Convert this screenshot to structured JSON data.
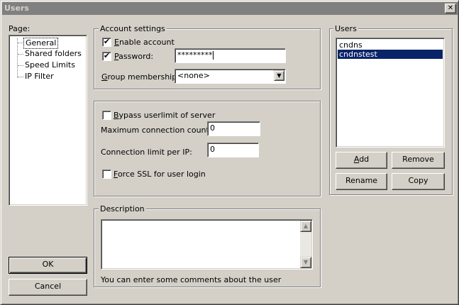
{
  "window": {
    "title": "Users",
    "close_glyph": "✕"
  },
  "page_panel": {
    "label": "Page:",
    "items": [
      "General",
      "Shared folders",
      "Speed Limits",
      "IP Filter"
    ],
    "selected_index": 0
  },
  "account_settings": {
    "title": "Account settings",
    "enable_account": {
      "label": "Enable account",
      "checked": true
    },
    "password": {
      "label": "Password:",
      "checked": true,
      "value": "*********"
    },
    "group_membership": {
      "label": "Group membership:",
      "value": "<none>"
    }
  },
  "limits": {
    "bypass_userlimit": {
      "label": "Bypass userlimit of server",
      "checked": false
    },
    "max_connections": {
      "label": "Maximum connection count:",
      "value": "0"
    },
    "connection_limit_ip": {
      "label": "Connection limit per IP:",
      "value": "0"
    },
    "force_ssl": {
      "label": "Force SSL for user login",
      "checked": false
    }
  },
  "description": {
    "title": "Description",
    "value": "",
    "hint": "You can enter some comments about the user"
  },
  "users_panel": {
    "title": "Users",
    "users": [
      "cndns",
      "cndnstest"
    ],
    "selected_index": 1,
    "add_label": "Add",
    "remove_label": "Remove",
    "rename_label": "Rename",
    "copy_label": "Copy"
  },
  "buttons": {
    "ok_label": "OK",
    "cancel_label": "Cancel"
  },
  "colors": {
    "selection": "#0a246a",
    "face": "#d4d0c8",
    "title_inactive": "#808080"
  },
  "icons": {
    "check": "✔",
    "dropdown": "▼",
    "scroll_up": "▲",
    "scroll_down": "▼"
  }
}
